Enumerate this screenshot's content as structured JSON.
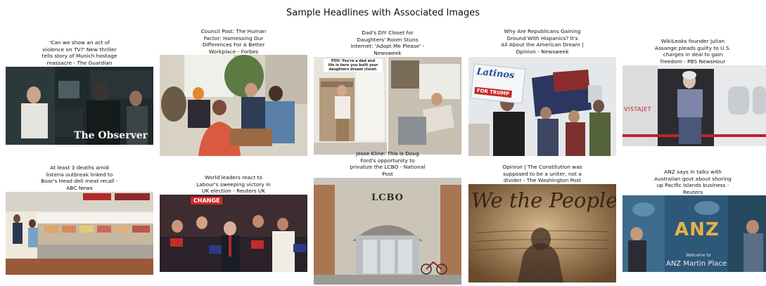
{
  "figure": {
    "title": "Sample Headlines with Associated Images"
  },
  "headlines": [
    {
      "text": "'Can we show an act of\nviolence on TV?' New thriller\ntells story of Munich hostage\nmassacre - The Guardian",
      "overlay": "The Observer"
    },
    {
      "text": "Council Post: The Human\nFactor: Harnessing Our\nDifferences For A Better\nWorkplace - Forbes"
    },
    {
      "text": "Dad's DIY Closet for\nDaughters' Room Stuns\nInternet: 'Adopt Me Please' -\nNewsweek",
      "overlay": "POV: You're a dad and\nlife is here you built your\ndaughters dream closet."
    },
    {
      "text": "Why Are Republicans Gaining\nGround With Hispanics? It's\nAll About the American Dream |\nOpinion - Newsweek",
      "sign_top": "Latinos",
      "sign_bottom": "FOR TRUMP"
    },
    {
      "text": "WikiLeaks founder Julian\nAssange pleads guilty to U.S.\ncharges in deal to gain\nfreedom - PBS NewsHour",
      "overlay": "VISTAJET"
    },
    {
      "text": "At least 3 deaths amid\nlisteria outbreak linked to\nBoar's Head deli meat recall -\nABC News"
    },
    {
      "text": "World leaders react to\nLabour's sweeping victory in\nUK election - Reuters UK",
      "overlay": "CHANGE"
    },
    {
      "text": "Jesse Kline: This is Doug\nFord's opportunity to\nprivatize the LCBO - National\nPost",
      "overlay": "LCBO"
    },
    {
      "text": "Opinion | The Constitution was\nsupposed to be a uniter, not a\ndivider - The Washington Post",
      "overlay": "We the People"
    },
    {
      "text": "ANZ says in talks with\nAustralian govt about shoring\nup Pacific Islands business -\nReuters",
      "overlay": "ANZ",
      "overlay2": "Welcome to",
      "overlay3": "ANZ Martin Place"
    }
  ]
}
